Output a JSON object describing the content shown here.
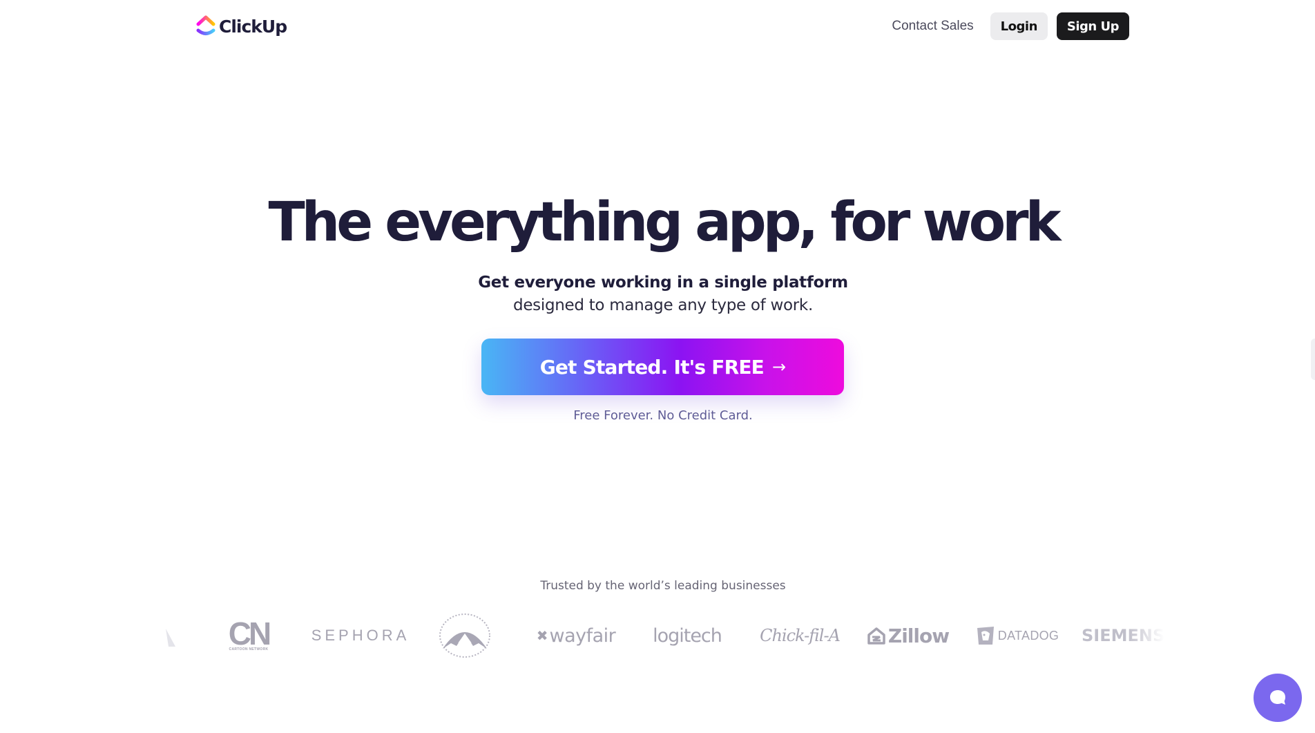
{
  "header": {
    "brand": "ClickUp",
    "nav": {
      "contact_label": "Contact Sales",
      "login_label": "Login",
      "signup_label": "Sign Up"
    }
  },
  "hero": {
    "title": "The everything app, for work",
    "subtitle_bold": "Get everyone working in a single platform",
    "subtitle_rest": " designed to manage any type of work.",
    "cta_label": "Get Started. It's FREE",
    "cta_arrow": "→",
    "cta_note": "Free Forever. No Credit Card."
  },
  "trusted": {
    "label": "Trusted by the world’s leading businesses",
    "logos": [
      {
        "name": "cartoon-network",
        "text": "CN",
        "subtext": "CARTOON NETWORK"
      },
      {
        "name": "sephora",
        "text": "SEPHORA"
      },
      {
        "name": "paramount",
        "text": "Paramount"
      },
      {
        "name": "wayfair",
        "text": "wayfair"
      },
      {
        "name": "logitech",
        "text": "logitech"
      },
      {
        "name": "chick-fil-a",
        "text": "Chick-fil-A"
      },
      {
        "name": "zillow",
        "text": "Zillow"
      },
      {
        "name": "datadog",
        "text": "DATADOG"
      },
      {
        "name": "siemens",
        "text": "SIEMENS"
      }
    ]
  },
  "colors": {
    "text_dark": "#1f1d3a",
    "brand_purple": "#7b68ee",
    "cta_gradient": [
      "#49b6f5",
      "#8c13f2",
      "#ee0bdd"
    ],
    "logo_gray": "#9c9aa8"
  },
  "icons": {
    "chat": "chat-bubble-icon",
    "arrow": "arrow-right-icon"
  }
}
